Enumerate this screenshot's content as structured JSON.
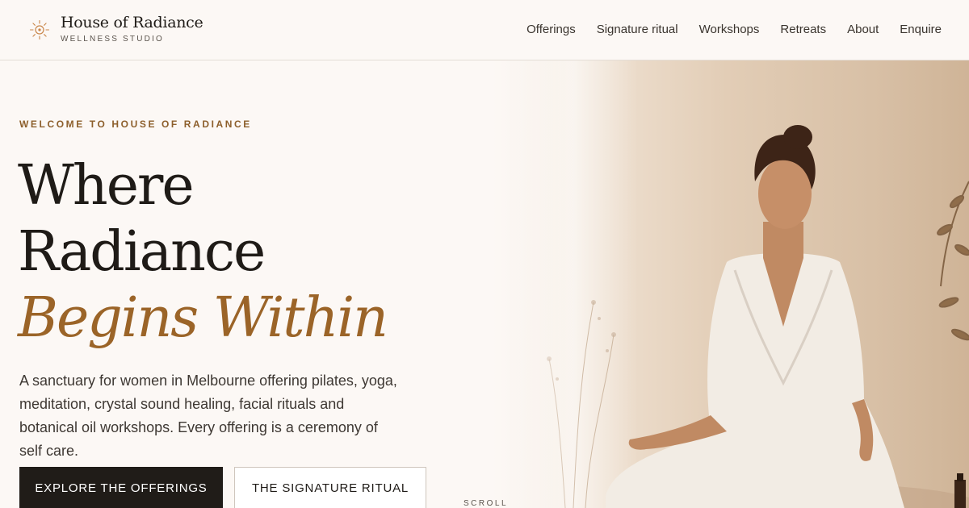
{
  "brand": {
    "name": "House of Radiance",
    "tagline": "WELLNESS STUDIO",
    "icon": "sun-icon",
    "accent_color": "#c9864a"
  },
  "nav": {
    "items": [
      {
        "label": "Offerings"
      },
      {
        "label": "Signature ritual"
      },
      {
        "label": "Workshops"
      },
      {
        "label": "Retreats"
      },
      {
        "label": "About"
      },
      {
        "label": "Enquire"
      }
    ]
  },
  "hero": {
    "eyebrow": "WELCOME TO HOUSE OF RADIANCE",
    "headline_line1": "Where",
    "headline_line2": "Radiance",
    "headline_accent": "Begins Within",
    "description": "A sanctuary for women in Melbourne offering pilates, yoga, meditation, crystal sound healing, facial rituals and botanical oil workshops. Every offering is a ceremony of self care.",
    "primary_button": "EXPLORE THE OFFERINGS",
    "secondary_button": "THE SIGNATURE RITUAL",
    "scroll_label": "SCROLL",
    "accent_color": "#9b6428",
    "image_subject": "woman-meditating-photo"
  }
}
